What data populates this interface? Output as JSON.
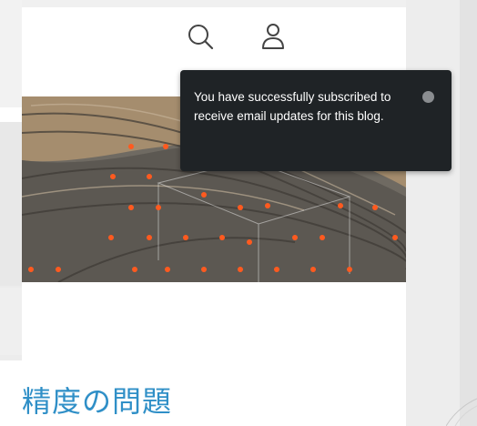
{
  "header": {
    "search_icon": "search-icon",
    "account_icon": "user-icon"
  },
  "toast": {
    "message": "You have successfully subscribed to receive email updates for this blog.",
    "close_icon": "close-icon"
  },
  "post": {
    "title": "精度の問題"
  },
  "colors": {
    "accent": "#2f8fc7",
    "toast_bg": "#1f2326",
    "marker": "#ff5a1f"
  }
}
